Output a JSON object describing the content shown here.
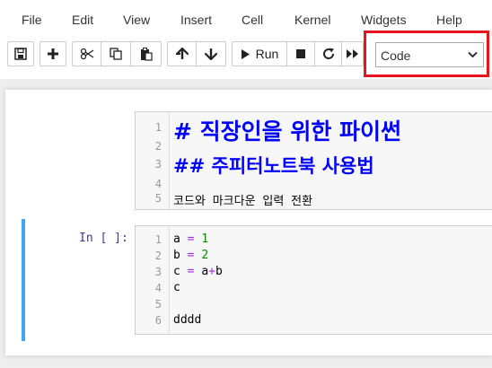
{
  "menu": [
    "File",
    "Edit",
    "View",
    "Insert",
    "Cell",
    "Kernel",
    "Widgets",
    "Help"
  ],
  "toolbar": {
    "save_icon": "save-icon",
    "insert_icon": "plus-icon",
    "cut_icon": "cut-icon",
    "copy_icon": "copy-icon",
    "paste_icon": "paste-icon",
    "move_up_icon": "arrow-up-icon",
    "move_down_icon": "arrow-down-icon",
    "run_label": "Run",
    "stop_icon": "stop-icon",
    "restart_icon": "refresh-icon",
    "run_all_icon": "fast-forward-icon",
    "cell_type_value": "Code",
    "highlight_color": "#e8141c"
  },
  "cells": [
    {
      "type": "markdown",
      "line_numbers": [
        "1",
        "2",
        "3",
        "4",
        "5"
      ],
      "lines": [
        "# 직장인을 위한 파이썬",
        "",
        "## 주피터노트북 사용법",
        "",
        "코드와 마크다운 입력 전환"
      ]
    },
    {
      "type": "code",
      "prompt": "In [ ]:",
      "line_numbers": [
        "1",
        "2",
        "3",
        "4",
        "5",
        "6"
      ],
      "lines": [
        "a = 1",
        "b = 2",
        "c = a+b",
        "c",
        "",
        "dddd"
      ],
      "tokens": {
        "l1_var": "a",
        "l1_op": "=",
        "l1_num": "1",
        "l2_var": "b",
        "l2_op": "=",
        "l2_num": "2",
        "l3_var": "c",
        "l3_op": "=",
        "l3_a": "a",
        "l3_plus": "+",
        "l3_b": "b"
      }
    }
  ],
  "colors": {
    "selected_bar": "#42a5f5",
    "heading": "#0000ff",
    "keyword_op": "#aa22ff",
    "number": "#008800"
  }
}
